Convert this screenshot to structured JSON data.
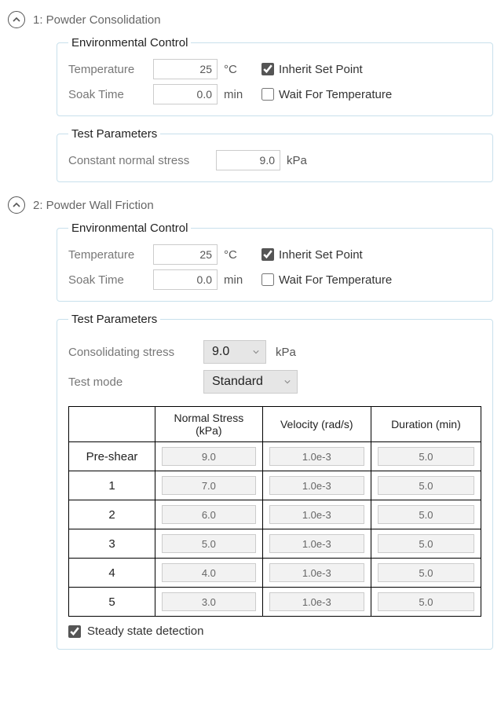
{
  "sections": [
    {
      "title": "1: Powder Consolidation",
      "env": {
        "legend": "Environmental Control",
        "temp_label": "Temperature",
        "temp_value": "25",
        "temp_unit": "°C",
        "inherit_label": "Inherit Set Point",
        "inherit_checked": true,
        "soak_label": "Soak Time",
        "soak_value": "0.0",
        "soak_unit": "min",
        "wait_label": "Wait For Temperature",
        "wait_checked": false
      },
      "test": {
        "legend": "Test Parameters",
        "cns_label": "Constant normal stress",
        "cns_value": "9.0",
        "cns_unit": "kPa"
      }
    },
    {
      "title": "2: Powder Wall Friction",
      "env": {
        "legend": "Environmental Control",
        "temp_label": "Temperature",
        "temp_value": "25",
        "temp_unit": "°C",
        "inherit_label": "Inherit Set Point",
        "inherit_checked": true,
        "soak_label": "Soak Time",
        "soak_value": "0.0",
        "soak_unit": "min",
        "wait_label": "Wait For Temperature",
        "wait_checked": false
      },
      "test2": {
        "legend": "Test Parameters",
        "cons_label": "Consolidating stress",
        "cons_value": "9.0",
        "cons_unit": "kPa",
        "mode_label": "Test mode",
        "mode_value": "Standard",
        "col1": "Normal Stress (kPa)",
        "col2": "Velocity (rad/s)",
        "col3": "Duration (min)",
        "rows": [
          {
            "label": "Pre-shear",
            "ns": "9.0",
            "vel": "1.0e-3",
            "dur": "5.0"
          },
          {
            "label": "1",
            "ns": "7.0",
            "vel": "1.0e-3",
            "dur": "5.0"
          },
          {
            "label": "2",
            "ns": "6.0",
            "vel": "1.0e-3",
            "dur": "5.0"
          },
          {
            "label": "3",
            "ns": "5.0",
            "vel": "1.0e-3",
            "dur": "5.0"
          },
          {
            "label": "4",
            "ns": "4.0",
            "vel": "1.0e-3",
            "dur": "5.0"
          },
          {
            "label": "5",
            "ns": "3.0",
            "vel": "1.0e-3",
            "dur": "5.0"
          }
        ],
        "steady_label": "Steady state detection",
        "steady_checked": true
      }
    }
  ]
}
